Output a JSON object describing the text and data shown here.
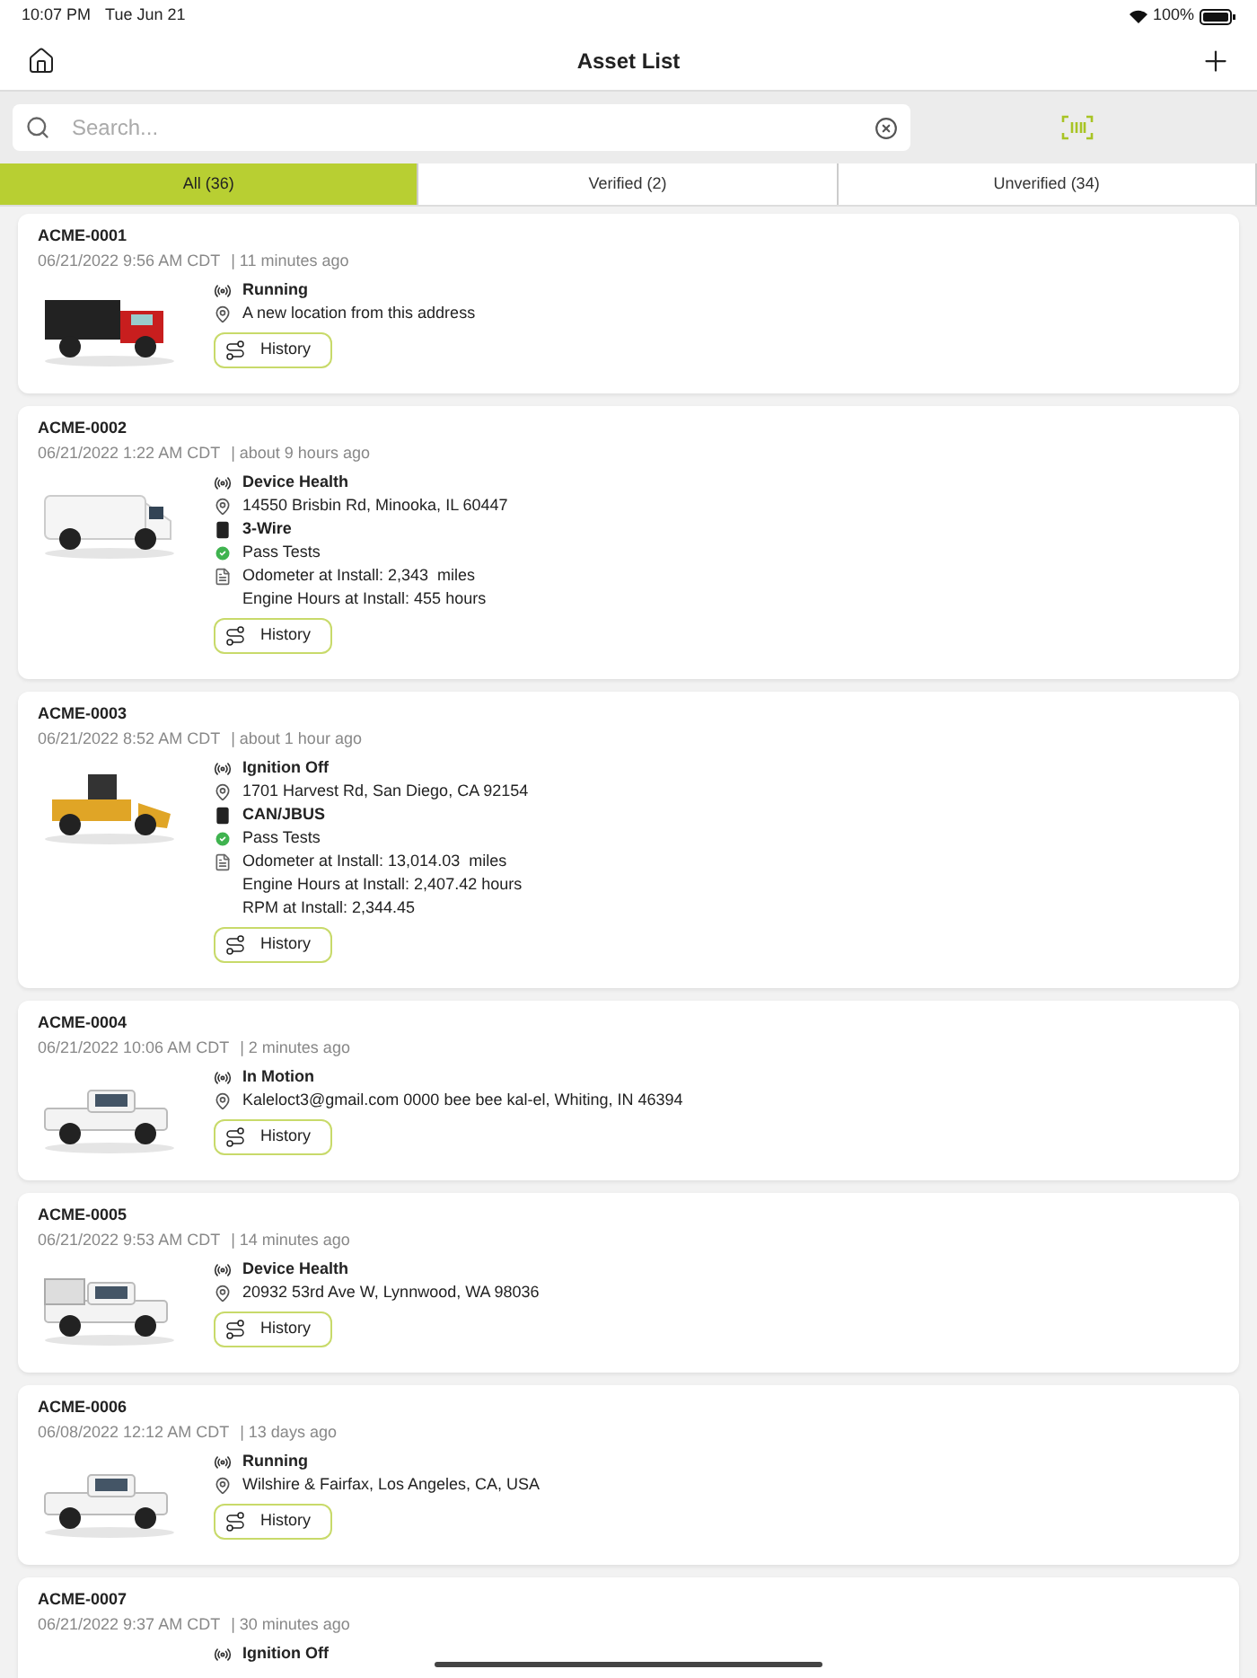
{
  "status_bar": {
    "time": "10:07 PM",
    "date": "Tue Jun 21",
    "battery": "100%"
  },
  "nav": {
    "title": "Asset List"
  },
  "search": {
    "placeholder": "Search..."
  },
  "tabs": [
    {
      "label": "All (36)",
      "selected": true
    },
    {
      "label": "Verified (2)",
      "selected": false
    },
    {
      "label": "Unverified (34)",
      "selected": false
    }
  ],
  "assets": [
    {
      "id": "ACME-0001",
      "date": "06/21/2022 9:56 AM CDT",
      "ago": "| 11 minutes ago",
      "details": [
        {
          "kind": "status",
          "text": "Running"
        },
        {
          "kind": "location",
          "text": "A new location from this address"
        }
      ],
      "button": "History"
    },
    {
      "id": "ACME-0002",
      "date": "06/21/2022 1:22 AM CDT",
      "ago": "| about 9 hours ago",
      "details": [
        {
          "kind": "status",
          "text": "Device Health"
        },
        {
          "kind": "location",
          "text": "14550 Brisbin Rd, Minooka, IL 60447"
        },
        {
          "kind": "wiring",
          "text": "3-Wire"
        },
        {
          "kind": "test",
          "text": "Pass Tests"
        },
        {
          "kind": "install",
          "lines": [
            "Odometer at Install: 2,343  miles",
            "Engine Hours at Install: 455 hours"
          ]
        }
      ],
      "button": "History"
    },
    {
      "id": "ACME-0003",
      "date": "06/21/2022 8:52 AM CDT",
      "ago": "| about 1 hour ago",
      "details": [
        {
          "kind": "status",
          "text": "Ignition Off"
        },
        {
          "kind": "location",
          "text": "1701 Harvest Rd, San Diego, CA 92154"
        },
        {
          "kind": "wiring",
          "text": "CAN/JBUS"
        },
        {
          "kind": "test",
          "text": "Pass Tests"
        },
        {
          "kind": "install",
          "lines": [
            "Odometer at Install: 13,014.03  miles",
            "Engine Hours at Install: 2,407.42 hours",
            "RPM at Install: 2,344.45"
          ]
        }
      ],
      "button": "History"
    },
    {
      "id": "ACME-0004",
      "date": "06/21/2022 10:06 AM CDT",
      "ago": "| 2 minutes ago",
      "details": [
        {
          "kind": "status",
          "text": "In Motion"
        },
        {
          "kind": "location",
          "text": "Kaleloct3@gmail.com 0000 bee bee kal-el, Whiting, IN 46394"
        }
      ],
      "button": "History"
    },
    {
      "id": "ACME-0005",
      "date": "06/21/2022 9:53 AM CDT",
      "ago": "| 14 minutes ago",
      "details": [
        {
          "kind": "status",
          "text": "Device Health"
        },
        {
          "kind": "location",
          "text": "20932 53rd Ave W, Lynnwood, WA 98036"
        }
      ],
      "button": "History"
    },
    {
      "id": "ACME-0006",
      "date": "06/08/2022 12:12 AM CDT",
      "ago": "| 13 days ago",
      "details": [
        {
          "kind": "status",
          "text": "Running"
        },
        {
          "kind": "location",
          "text": "Wilshire & Fairfax, Los Angeles, CA, USA"
        }
      ],
      "button": "History"
    },
    {
      "id": "ACME-0007",
      "date": "06/21/2022 9:37 AM CDT",
      "ago": "| 30 minutes ago",
      "details": [
        {
          "kind": "status",
          "text": "Ignition Off"
        }
      ]
    }
  ]
}
